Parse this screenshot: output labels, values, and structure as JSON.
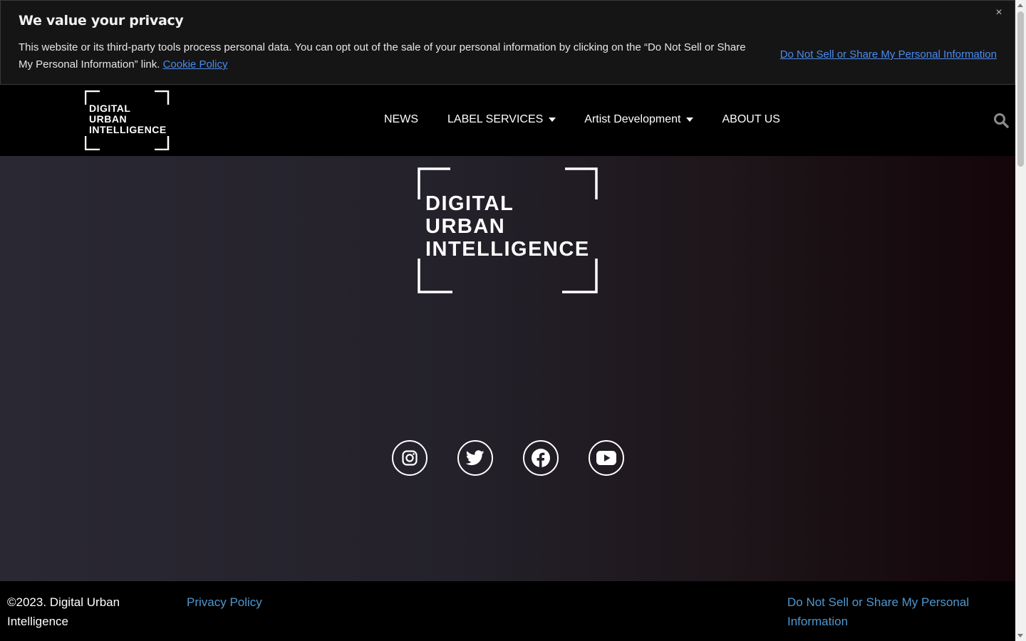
{
  "cookie_banner": {
    "title": "We value your privacy",
    "body": "This website or its third-party tools process personal data. You can opt out of the sale of your personal information by clicking on the “Do Not Sell or Share My Personal Information” link.",
    "cookie_policy_link": "Cookie Policy",
    "do_not_sell_link": "Do Not Sell or Share My Personal Information",
    "close_label": "×"
  },
  "header": {
    "logo_lines": [
      "DIGITAL",
      "URBAN",
      "INTELLIGENCE"
    ],
    "nav": [
      {
        "label": "NEWS",
        "dropdown": false
      },
      {
        "label": "LABEL SERVICES",
        "dropdown": true
      },
      {
        "label": "Artist Development",
        "dropdown": true
      },
      {
        "label": "ABOUT US",
        "dropdown": false
      }
    ],
    "search_icon": "search-icon"
  },
  "hero": {
    "logo_lines": [
      "DIGITAL",
      "URBAN",
      "INTELLIGENCE"
    ],
    "socials": [
      {
        "name": "instagram-icon"
      },
      {
        "name": "twitter-icon"
      },
      {
        "name": "facebook-icon"
      },
      {
        "name": "youtube-icon"
      }
    ]
  },
  "footer": {
    "copyright": "©2023. Digital Urban Intelligence",
    "privacy_policy": "Privacy Policy",
    "do_not_sell": "Do Not Sell or Share My Personal Information"
  },
  "colors": {
    "link_blue": "#4a8cf0",
    "footer_link": "#4e97cf",
    "banner_bg": "#151515"
  }
}
